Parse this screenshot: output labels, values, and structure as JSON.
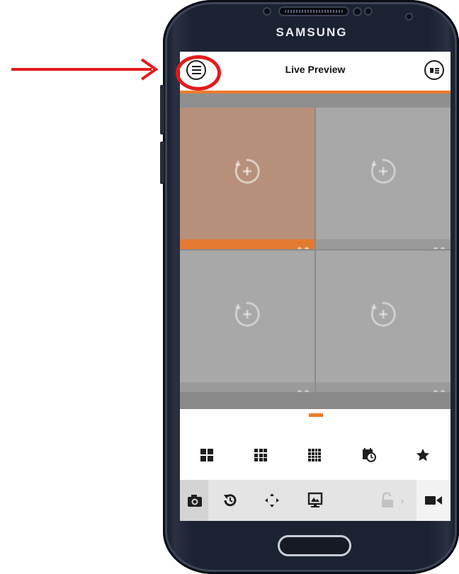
{
  "device": {
    "brand": "SAMSUNG"
  },
  "app": {
    "header": {
      "title": "Live Preview"
    },
    "channels": [
      {
        "state": "active"
      },
      {
        "state": "empty"
      },
      {
        "state": "empty"
      },
      {
        "state": "empty"
      }
    ],
    "layout_buttons": [
      "split-4-icon",
      "split-9-icon",
      "split-16-icon",
      "schedule-icon",
      "favorite-star-icon"
    ],
    "action_buttons": [
      "snapshot-camera-icon",
      "playback-icon",
      "ptz-icon",
      "image-adjust-icon",
      "unlock-icon",
      "record-video-icon"
    ]
  },
  "colors": {
    "accent": "#f07c2a",
    "annotation": "#e41b1b",
    "active_cell": "#b6907a",
    "empty_cell": "#a8a8a8"
  }
}
